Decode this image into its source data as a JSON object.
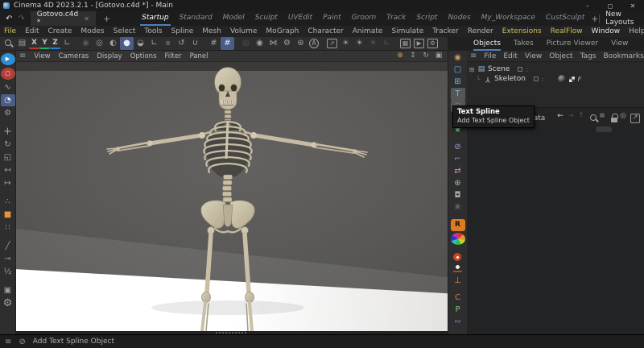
{
  "colors": {
    "accent_blue": "#4f7fbf",
    "selection_blue": "#4a5d86",
    "menu_accent_yellow": "#cdbe60",
    "redshift_orange": "#e07a1f",
    "bone": "#cfc6ae"
  },
  "title_bar": {
    "title": "Cinema 4D 2023.2.1 - [Gotovo.c4d *] - Main",
    "minimize": "–",
    "restore": "◻",
    "close": "✕"
  },
  "workspace_bar": {
    "undo": "↶",
    "redo": "↷",
    "document_tab": "Gotovo.c4d *",
    "tab_close": "✕",
    "new_document": "+",
    "layouts": [
      {
        "label": "Startup",
        "active": true
      },
      {
        "label": "Standard"
      },
      {
        "label": "Model"
      },
      {
        "label": "Sculpt"
      },
      {
        "label": "UVEdit"
      },
      {
        "label": "Paint"
      },
      {
        "label": "Groom"
      },
      {
        "label": "Track"
      },
      {
        "label": "Script"
      },
      {
        "label": "Nodes"
      },
      {
        "label": "My_Workspace"
      },
      {
        "label": "CustSculpt"
      }
    ],
    "add_layout": "+",
    "new_layouts_label": "New Layouts"
  },
  "menu_bar": {
    "items": [
      {
        "label": "File",
        "accent": true
      },
      {
        "label": "Edit"
      },
      {
        "label": "Create"
      },
      {
        "label": "Modes"
      },
      {
        "label": "Select"
      },
      {
        "label": "Tools"
      },
      {
        "label": "Spline"
      },
      {
        "label": "Mesh"
      },
      {
        "label": "Volume"
      },
      {
        "label": "MoGraph"
      },
      {
        "label": "Character"
      },
      {
        "label": "Animate"
      },
      {
        "label": "Simulate"
      },
      {
        "label": "Tracker"
      },
      {
        "label": "Render"
      },
      {
        "label": "Extensions",
        "accent": true
      },
      {
        "label": "RealFlow",
        "accent": true
      },
      {
        "label": "Window",
        "bright": true
      },
      {
        "label": "Help"
      }
    ]
  },
  "toolbar": {
    "icons": [
      {
        "name": "find-icon",
        "cls": "mag"
      },
      {
        "name": "history-icon",
        "glyph": "▤"
      },
      {
        "name": "axis-x-lock",
        "glyph": "X",
        "cls": "axis ax-x"
      },
      {
        "name": "axis-y-lock",
        "glyph": "Y",
        "cls": "axis ax-y"
      },
      {
        "name": "axis-z-lock",
        "glyph": "Z",
        "cls": "axis ax-z"
      },
      {
        "name": "coordinate-system-icon",
        "glyph": "∟"
      },
      {
        "sep": true
      },
      {
        "name": "workplane-icon",
        "glyph": "◉",
        "dim": true
      },
      {
        "name": "planar-workplane-icon",
        "glyph": "◎"
      },
      {
        "name": "sphere-half-icon",
        "glyph": "◐"
      },
      {
        "name": "visible-objects-icon",
        "glyph": "●",
        "sel": true
      },
      {
        "name": "gravity-icon",
        "glyph": "◒"
      },
      {
        "name": "workplane-corner-icon",
        "glyph": "∟"
      },
      {
        "name": "quantize-icon",
        "glyph": "▪",
        "dim": true
      },
      {
        "name": "undo-workplane-icon",
        "glyph": "↺"
      },
      {
        "name": "magnet-icon",
        "glyph": "∪"
      },
      {
        "sep": true
      },
      {
        "name": "grid-icon",
        "glyph": "#"
      },
      {
        "name": "snap-enabled-icon",
        "glyph": "#",
        "sel": true
      },
      {
        "sep": true
      },
      {
        "name": "target-dim-icon",
        "glyph": "◎",
        "dim": true
      },
      {
        "name": "target-icon",
        "glyph": "◉"
      },
      {
        "name": "symmetry-icon",
        "glyph": "⋈"
      },
      {
        "name": "modifier-icon",
        "glyph": "⚙"
      },
      {
        "name": "gear-ring-icon",
        "glyph": "⊛"
      },
      {
        "name": "autokey-icon",
        "glyph": "A",
        "cls": "circ"
      },
      {
        "sep": true
      },
      {
        "name": "export-icon",
        "glyph": "↗",
        "cls": "bx"
      },
      {
        "name": "spark-icon",
        "glyph": "☀"
      },
      {
        "name": "spark-alt-icon",
        "glyph": "☀"
      },
      {
        "name": "spark-dim-icon",
        "glyph": "☀",
        "dim": true
      },
      {
        "name": "corner-dim-icon",
        "glyph": "∟",
        "dim": true
      },
      {
        "sep": true
      },
      {
        "name": "render-view-button",
        "glyph": "▦",
        "cls": "bx"
      },
      {
        "name": "render-picture-viewer-button",
        "glyph": "▶",
        "cls": "bx"
      },
      {
        "name": "render-settings-button",
        "glyph": "⚙",
        "cls": "bx"
      },
      {
        "sep": true
      },
      {
        "name": "material-ring-icon",
        "glyph": "◍"
      },
      {
        "sep": true
      },
      {
        "name": "coordinates-icon",
        "glyph": "∟"
      }
    ]
  },
  "left_toolbar": {
    "icons": [
      {
        "name": "live-selection-tool",
        "glyph": "▶",
        "cls": "cir",
        "color": "#fff",
        "bg": "#2f8fd4"
      },
      {
        "name": "rectangle-selection-tool",
        "glyph": "▢",
        "cls": "cir",
        "color": "#fff",
        "bg": "#b04038"
      },
      {
        "name": "lasso-selection-tool",
        "glyph": "∿"
      },
      {
        "name": "active-tool-icon",
        "glyph": "◔",
        "sel": true
      },
      {
        "name": "tool-options-icon",
        "glyph": "⚙"
      },
      {
        "sep": true
      },
      {
        "name": "move-tool",
        "glyph": "+",
        "cls": "big"
      },
      {
        "name": "rotate-tool",
        "glyph": "↻"
      },
      {
        "name": "scale-tool",
        "glyph": "◱"
      },
      {
        "name": "transform-left-icon",
        "glyph": "↤"
      },
      {
        "name": "transform-right-icon",
        "glyph": "↦"
      },
      {
        "sep": true
      },
      {
        "name": "point-mode",
        "glyph": "∴",
        "color": "#e8923a"
      },
      {
        "name": "model-mode",
        "glyph": "■",
        "color": "#e8923a"
      },
      {
        "name": "polygon-mode",
        "glyph": "∷",
        "color": "#e8923a"
      },
      {
        "sep": true
      },
      {
        "name": "pen-icon",
        "glyph": "╱"
      },
      {
        "name": "edge-mode",
        "glyph": "⊸"
      },
      {
        "name": "half-weight-icon",
        "glyph": "½"
      },
      {
        "sep": true
      },
      {
        "name": "texture-mode",
        "glyph": "▣"
      },
      {
        "name": "settings-gear",
        "glyph": "⚙",
        "cls": "big"
      }
    ]
  },
  "viewport": {
    "hamburger": "≡",
    "menu_items": [
      "View",
      "Cameras",
      "Display",
      "Options",
      "Filter",
      "Panel"
    ],
    "nav_icons": [
      {
        "name": "pan-view-icon",
        "glyph": "⊕",
        "color": "#c8a05e"
      },
      {
        "name": "zoom-view-icon",
        "glyph": "↕"
      },
      {
        "name": "rotate-view-icon",
        "glyph": "↻"
      },
      {
        "name": "toggle-view-icon",
        "glyph": "▣"
      }
    ]
  },
  "right_strip": {
    "icons": [
      {
        "name": "pen-tablet-icon",
        "glyph": "◉",
        "color": "#c39b62"
      },
      {
        "name": "spline-rectangle-icon",
        "glyph": "▢",
        "color": "#6fb7e8"
      },
      {
        "name": "cube-primitive-icon",
        "glyph": "⊞",
        "color": "#6fb7e8"
      },
      {
        "name": "text-object-icon",
        "glyph": "T",
        "color": "#6fb7e8",
        "cls": "hov"
      },
      {
        "name": "text-spline-icon",
        "glyph": "◌",
        "color": "#7ed87e",
        "cls": "hov"
      },
      {
        "name": "subdivision-surface-icon",
        "glyph": "♣",
        "color": "#7ed87e"
      },
      {
        "name": "generator-icon",
        "glyph": "★",
        "color": "#7ed87e"
      },
      {
        "sep": true
      },
      {
        "name": "spline-mask-icon",
        "glyph": "⊘",
        "color": "#b49be0"
      },
      {
        "name": "tracer-icon",
        "glyph": "⌐",
        "color": "#b49be0"
      },
      {
        "name": "instance-icon",
        "glyph": "⇄",
        "color": "#d88bd8"
      },
      {
        "name": "sky-icon",
        "glyph": "⊕",
        "color": "#9ab4c4"
      },
      {
        "name": "camera-icon",
        "glyph": "◘",
        "color": "#a8a8a8"
      },
      {
        "name": "light-icon",
        "glyph": "☼",
        "color": "#a8a8a8"
      },
      {
        "sep": true
      },
      {
        "name": "redshift-material-icon",
        "glyph": "R",
        "cls": "rs"
      },
      {
        "name": "material-wheel-icon",
        "cls": "wheel"
      },
      {
        "sep": true
      },
      {
        "name": "target-light-icon",
        "cls": "reddot"
      },
      {
        "name": "nail-tag-icon",
        "cls": "nail"
      },
      {
        "name": "ies-light-icon",
        "glyph": "⊥",
        "color": "#e8923a"
      },
      {
        "sep": true
      },
      {
        "name": "c-tag-icon",
        "glyph": "C",
        "color": "#d07858"
      },
      {
        "name": "p-tag-icon",
        "glyph": "P",
        "color": "#7ec87e"
      },
      {
        "name": "python-icon",
        "glyph": "∾",
        "color": "#8a7ad8"
      }
    ]
  },
  "right_panel": {
    "tabs": [
      {
        "label": "Objects",
        "active": true
      },
      {
        "label": "Takes"
      },
      {
        "label": "Picture Viewer"
      },
      {
        "label": "View"
      }
    ],
    "hamburger": "≡",
    "menu_items": [
      "File",
      "Edit",
      "View",
      "Object",
      "Tags",
      "Bookmarks"
    ],
    "om_icons": [
      {
        "name": "om-search-icon",
        "cls": "mag"
      },
      {
        "name": "om-home-icon",
        "glyph": "⌂"
      },
      {
        "name": "om-filter-icon",
        "glyph": "≡"
      },
      {
        "name": "om-popout-icon",
        "glyph": "↗",
        "cls": "bx"
      }
    ],
    "tree": [
      {
        "label": "Scene"
      },
      {
        "label": "Skeleton"
      }
    ],
    "attribute_bar": {
      "partial_text": "ser Data",
      "icons": [
        {
          "name": "attr-back-icon",
          "glyph": "←",
          "color": "#dcdcdc"
        },
        {
          "name": "attr-forward-icon",
          "glyph": "→",
          "color": "#555555"
        },
        {
          "name": "attr-up-icon",
          "glyph": "↑",
          "color": "#555555"
        },
        {
          "name": "attr-search-icon",
          "cls": "mag"
        },
        {
          "name": "attr-filter-icon",
          "glyph": "≡"
        },
        {
          "name": "attr-lock-icon",
          "cls": "lock"
        },
        {
          "name": "attr-target-icon",
          "glyph": "◎"
        },
        {
          "name": "attr-popout-icon",
          "glyph": "↗",
          "cls": "bx"
        }
      ]
    }
  },
  "tooltip": {
    "title": "Text Spline",
    "subtitle": "Add Text Spline Object"
  },
  "status_bar": {
    "hamburger": "≡",
    "circle": "⊘",
    "message": "Add Text Spline Object"
  }
}
